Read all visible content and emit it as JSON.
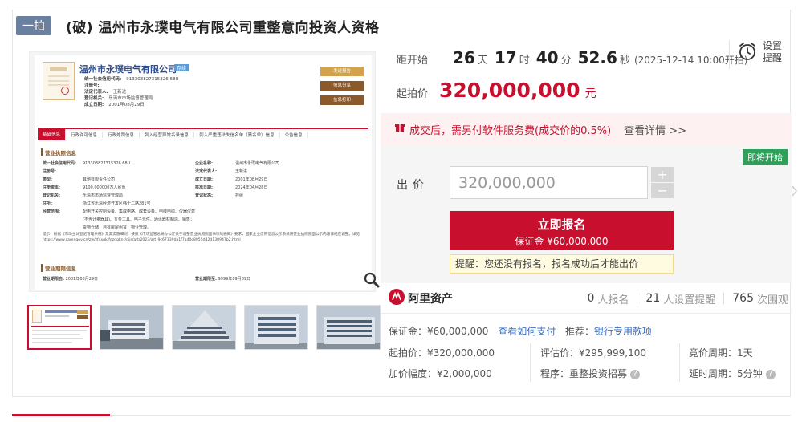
{
  "header": {
    "tag": "一拍",
    "title": "(破) 温州市永璞电气有限公司重整意向投资人资格"
  },
  "document_image": {
    "company_name": "温州市永璞电气有限公司",
    "status_chip": "存续",
    "fields": [
      {
        "label": "统一社会信用代码:",
        "value": "913303827315326 68U"
      },
      {
        "label": "注册号:",
        "value": ""
      },
      {
        "label": "法定代表人:",
        "value": "王新进"
      },
      {
        "label": "登记机关:",
        "value": "乐清市市场监督管理局"
      },
      {
        "label": "成立日期:",
        "value": "2001年08月29日"
      }
    ],
    "side_buttons": [
      "发送报告",
      "信息分享",
      "信息打印"
    ],
    "tabs": [
      "基础信息",
      "行政许可信息",
      "行政处罚信息",
      "列入经营异常名录信息",
      "列入严重违法失信名单（黑名单）信息",
      "公告信息"
    ],
    "section1": "营业执照信息",
    "left_rows": [
      {
        "label": "统一社会信用代码:",
        "value": "913303827315326 68U"
      },
      {
        "label": "注册号:",
        "value": ""
      },
      {
        "label": "类型:",
        "value": "其他有限责任公司"
      },
      {
        "label": "注册资本:",
        "value": "9100.000000万人民币"
      },
      {
        "label": "登记机关:",
        "value": "乐清市市场监督管理局"
      },
      {
        "label": "住所:",
        "value": "浙江省乐清经济开发区纬十二路281号"
      },
      {
        "label": "经营范围:",
        "value": "配电开关控制设备、集成电路、成套设备、电线电缆、仪器仪表(不含计量器具)、五金工具、电子元件、通讯器材制造、销售；货物仓储；自有房屋租赁；物业管理。"
      }
    ],
    "right_rows": [
      {
        "label": "企业名称:",
        "value": "温州市永璞电气有限公司"
      },
      {
        "label": "法定代表人:",
        "value": "王新进"
      },
      {
        "label": "成立日期:",
        "value": "2001年08月29日"
      },
      {
        "label": "核准日期:",
        "value": "2024年04月28日"
      },
      {
        "label": "登记状态:",
        "value": "存续"
      }
    ],
    "note": "提示：根据《市场主体登记管理条例》及其实施细则，按照《市场监管总局办公厅关于调整营业执照照面事项的通知》要求，国家企业信用信息公示系统将营业执照照面公示内容作相应调整。详见https://www.samr.gov.cn/zw/zfxxgk/fdzdgknr/djjs/art/2023/art_9c67139da1f7a40c8955d42d130947b2.html",
    "section2": "营业期限信息",
    "term_from_label": "营业期限自:",
    "term_from": "2001年08月29日",
    "term_to_label": "营业期限至:",
    "term_to": "9999年09月09日"
  },
  "countdown": {
    "label": "距开始",
    "days": "26",
    "days_unit": "天",
    "hours": "17",
    "hours_unit": "时",
    "minutes": "40",
    "minutes_unit": "分",
    "seconds": "52.6",
    "seconds_unit": "秒",
    "start_time": "(2025-12-14 10:00开拍)"
  },
  "alert": {
    "line1": "设置",
    "line2": "提醒"
  },
  "starting_price": {
    "label": "起拍价",
    "value": "320,000,000",
    "unit": "元"
  },
  "notice": {
    "text": "成交后，需另付软件服务费(成交价的0.5%)",
    "link": "查看详情 >>"
  },
  "status_badge": "即将开始",
  "bid": {
    "label": "出价",
    "value": "320,000,000",
    "plus": "+",
    "minus": "−",
    "button_line1": "立即报名",
    "button_line2": "保证金 ¥60,000,000",
    "tip": "提醒：您还没有报名，报名成功后才能出价"
  },
  "platform": {
    "name": "阿里资产",
    "registered_count": "0",
    "registered_label": "人报名",
    "alert_count": "21",
    "alert_label": "人设置提醒",
    "views_count": "765",
    "views_label": "次围观"
  },
  "details": {
    "deposit_label": "保证金：",
    "deposit": "¥60,000,000",
    "pay_link": "查看如何支付",
    "recommend_label": "推荐：",
    "recommend": "银行专用款项",
    "start_price_label": "起拍价：",
    "start_price": "¥320,000,000",
    "appraisal_label": "评估价：",
    "appraisal": "¥295,999,100",
    "cycle_label": "竞价周期：",
    "cycle": "1天",
    "increment_label": "加价幅度：",
    "increment": "¥2,000,000",
    "procedure_label": "程序：",
    "procedure": "重整投资招募",
    "delay_label": "延时周期：",
    "delay": "5分钟"
  },
  "colors": {
    "accent": "#c8102e",
    "tag": "#6b7f9e",
    "green": "#2ea05a",
    "link": "#3a6fbf"
  }
}
